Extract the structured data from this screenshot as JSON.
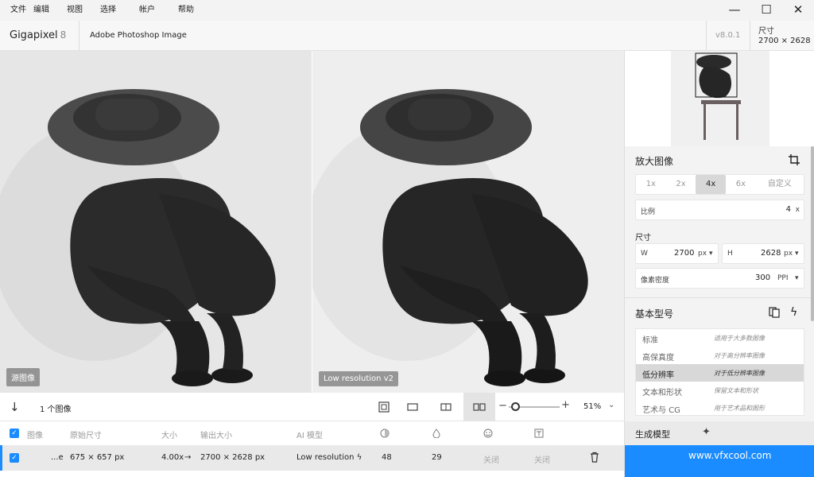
{
  "menu": {
    "items": [
      "文件",
      "编辑",
      "视图",
      "选择",
      "帐户",
      "帮助"
    ]
  },
  "window_controls": {
    "minimize": "—",
    "maximize": "☐",
    "close": "✕"
  },
  "header": {
    "app_name": "Gigapixel",
    "app_version_badge": "8",
    "file_type": "Adobe Photoshop Image",
    "version": "v8.0.1",
    "dimensions_label": "尺寸",
    "dimensions_value": "2700 × 2628"
  },
  "preview": {
    "left_tag": "源图像",
    "right_tag": "Low resolution v2"
  },
  "toolbar": {
    "image_count": "1 个图像",
    "zoom_value": "51%",
    "zoom_level": 0.05
  },
  "table": {
    "headers": {
      "image": "图像",
      "original_size": "原始尺寸",
      "scale": "大小",
      "output_size": "输出大小",
      "ai_model": "AI 模型"
    },
    "row": {
      "name": "...e",
      "original_size": "675 × 657 px",
      "scale": "4.00x",
      "arrow": "→",
      "output_size": "2700 × 2628 px",
      "ai_model": "Low resolution",
      "col1": "48",
      "col2": "29",
      "col3": "关闭",
      "col4": "关闭"
    }
  },
  "sidebar": {
    "upscale_title": "放大图像",
    "scale_options": [
      "1x",
      "2x",
      "4x",
      "6x",
      "自定义"
    ],
    "selected_scale": "4x",
    "ratio_label": "比例",
    "ratio_value": "4",
    "ratio_unit": "x",
    "size_title": "尺寸",
    "width_label": "W",
    "width_value": "2700",
    "width_unit": "px",
    "height_label": "H",
    "height_value": "2628",
    "height_unit": "px",
    "dpi_label": "像素密度",
    "dpi_value": "300",
    "dpi_unit": "PPI",
    "model_title": "基本型号",
    "models": [
      {
        "name": "标准",
        "desc": "适用于大多数图像"
      },
      {
        "name": "高保真度",
        "desc": "对于高分辨率图像"
      },
      {
        "name": "低分辨率",
        "desc": "对于低分辨率图像"
      },
      {
        "name": "文本和形状",
        "desc": "保留文本和形状"
      },
      {
        "name": "艺术与 CG",
        "desc": "用于艺术品和图形"
      }
    ],
    "selected_model": "低分辨率",
    "generate_label": "生成模型"
  },
  "watermark": "www.vfxcool.com",
  "colors": {
    "accent": "#1a8cff"
  }
}
